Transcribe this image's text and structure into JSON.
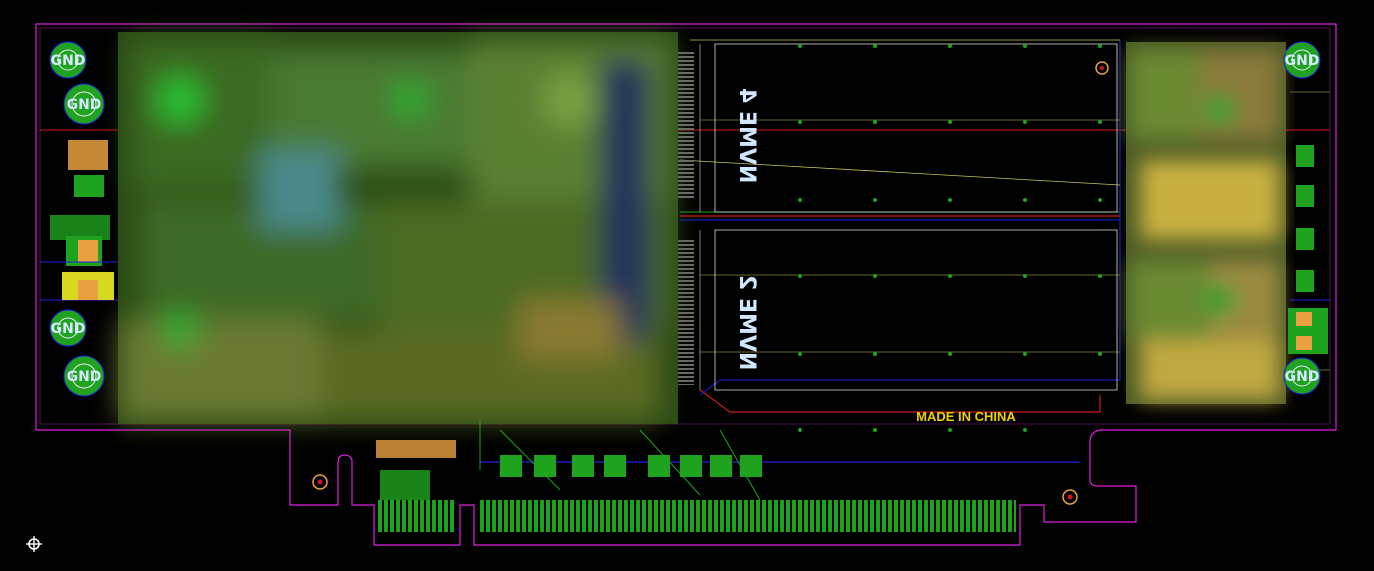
{
  "labels": {
    "gnd": "GND",
    "nvme_top": "NVME 4",
    "nvme_bottom": "NVME 2",
    "made_in": "MADE IN CHINA"
  },
  "colors": {
    "background": "#000000",
    "outline": "#e020e0",
    "copper_green": "#1fa31f",
    "silkscreen": "#e8e000",
    "trace_red": "#d01818",
    "trace_blue": "#2020e0",
    "pad_orange": "#e8a040",
    "trace_yellow": "#c8c850"
  },
  "icons": {
    "origin": "origin-crosshair-icon",
    "hole": "fiducial-hole-icon"
  }
}
